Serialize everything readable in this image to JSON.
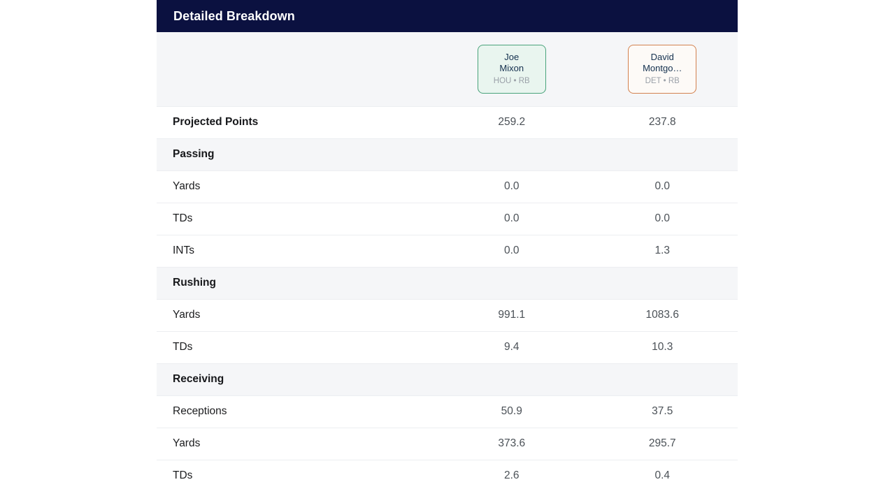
{
  "panel": {
    "title": "Detailed Breakdown"
  },
  "players": [
    {
      "first_name": "Joe",
      "last_name": "Mixon",
      "team": "HOU",
      "position": "RB",
      "meta": "HOU • RB",
      "accent_color": "#4aa37b",
      "background_color": "#e9f5ef"
    },
    {
      "first_name": "David",
      "last_name": "Montgo…",
      "team": "DET",
      "position": "RB",
      "meta": "DET • RB",
      "accent_color": "#d3824f",
      "background_color": "#fdfaf7"
    }
  ],
  "rows": [
    {
      "kind": "total",
      "label": "Projected Points",
      "values": [
        "259.2",
        "237.8"
      ]
    },
    {
      "kind": "section",
      "label": "Passing",
      "values": [
        "",
        ""
      ]
    },
    {
      "kind": "stat",
      "label": "Yards",
      "values": [
        "0.0",
        "0.0"
      ]
    },
    {
      "kind": "stat",
      "label": "TDs",
      "values": [
        "0.0",
        "0.0"
      ]
    },
    {
      "kind": "stat",
      "label": "INTs",
      "values": [
        "0.0",
        "1.3"
      ]
    },
    {
      "kind": "section",
      "label": "Rushing",
      "values": [
        "",
        ""
      ]
    },
    {
      "kind": "stat",
      "label": "Yards",
      "values": [
        "991.1",
        "1083.6"
      ]
    },
    {
      "kind": "stat",
      "label": "TDs",
      "values": [
        "9.4",
        "10.3"
      ]
    },
    {
      "kind": "section",
      "label": "Receiving",
      "values": [
        "",
        ""
      ]
    },
    {
      "kind": "stat",
      "label": "Receptions",
      "values": [
        "50.9",
        "37.5"
      ]
    },
    {
      "kind": "stat",
      "label": "Yards",
      "values": [
        "373.6",
        "295.7"
      ]
    },
    {
      "kind": "stat",
      "label": "TDs",
      "values": [
        "2.6",
        "0.4"
      ]
    }
  ],
  "theme": {
    "header_background": "#0b1140",
    "header_text": "#ffffff",
    "section_background": "#f5f6f8",
    "row_divider": "#eceef1",
    "label_text": "#1c1d1f",
    "value_text": "#4b5157",
    "player_name_text": "#14304e",
    "player_meta_text": "#9aa0a8"
  }
}
